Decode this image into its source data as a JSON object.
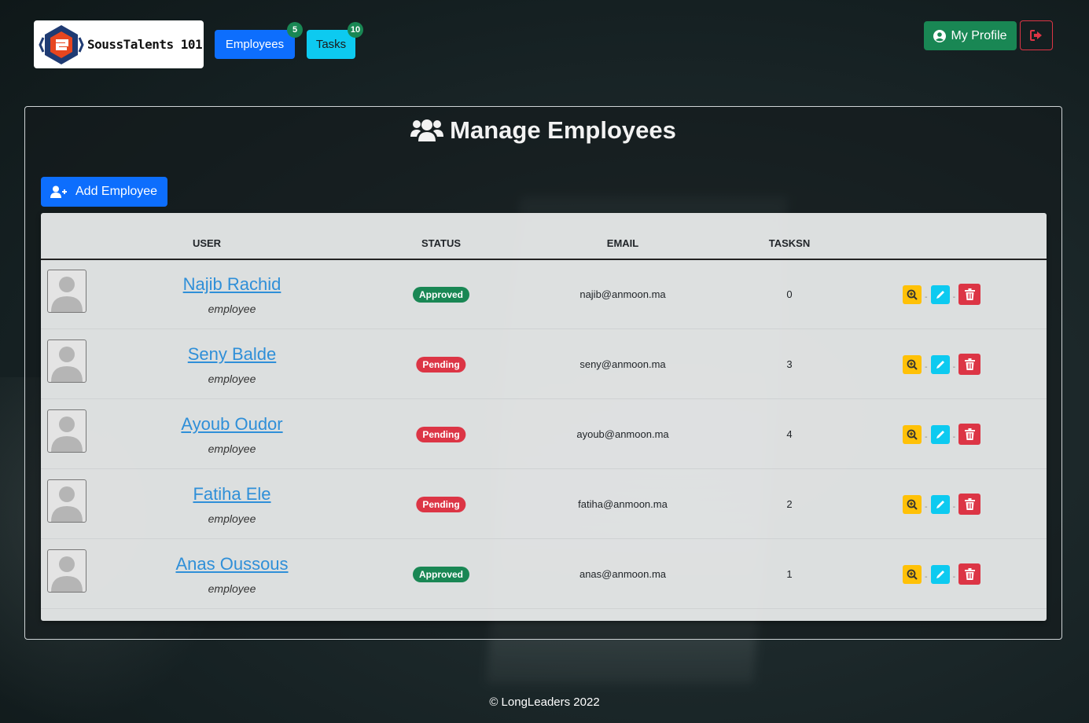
{
  "brand": {
    "name": "SoussTalents 101"
  },
  "nav": {
    "employees_label": "Employees",
    "employees_count": "5",
    "tasks_label": "Tasks",
    "tasks_count": "10"
  },
  "header": {
    "profile_label": "My Profile"
  },
  "main": {
    "title": "Manage Employees",
    "add_button": "Add Employee",
    "columns": [
      "USER",
      "STATUS",
      "EMAIL",
      "TASKSN"
    ],
    "rows": [
      {
        "name": "Najib Rachid",
        "role": "employee",
        "status": "Approved",
        "email": "najib@anmoon.ma",
        "tasks": "0"
      },
      {
        "name": "Seny Balde",
        "role": "employee",
        "status": "Pending",
        "email": "seny@anmoon.ma",
        "tasks": "3"
      },
      {
        "name": "Ayoub Oudor",
        "role": "employee",
        "status": "Pending",
        "email": "ayoub@anmoon.ma",
        "tasks": "4"
      },
      {
        "name": "Fatiha Ele",
        "role": "employee",
        "status": "Pending",
        "email": "fatiha@anmoon.ma",
        "tasks": "2"
      },
      {
        "name": "Anas Oussous",
        "role": "employee",
        "status": "Approved",
        "email": "anas@anmoon.ma",
        "tasks": "1"
      }
    ],
    "action_separator": "-"
  },
  "footer": {
    "text": "© LongLeaders 2022"
  },
  "colors": {
    "primary": "#0d6efd",
    "info": "#0dcaf0",
    "success": "#198754",
    "danger": "#dc3545",
    "warning": "#ffc107"
  }
}
